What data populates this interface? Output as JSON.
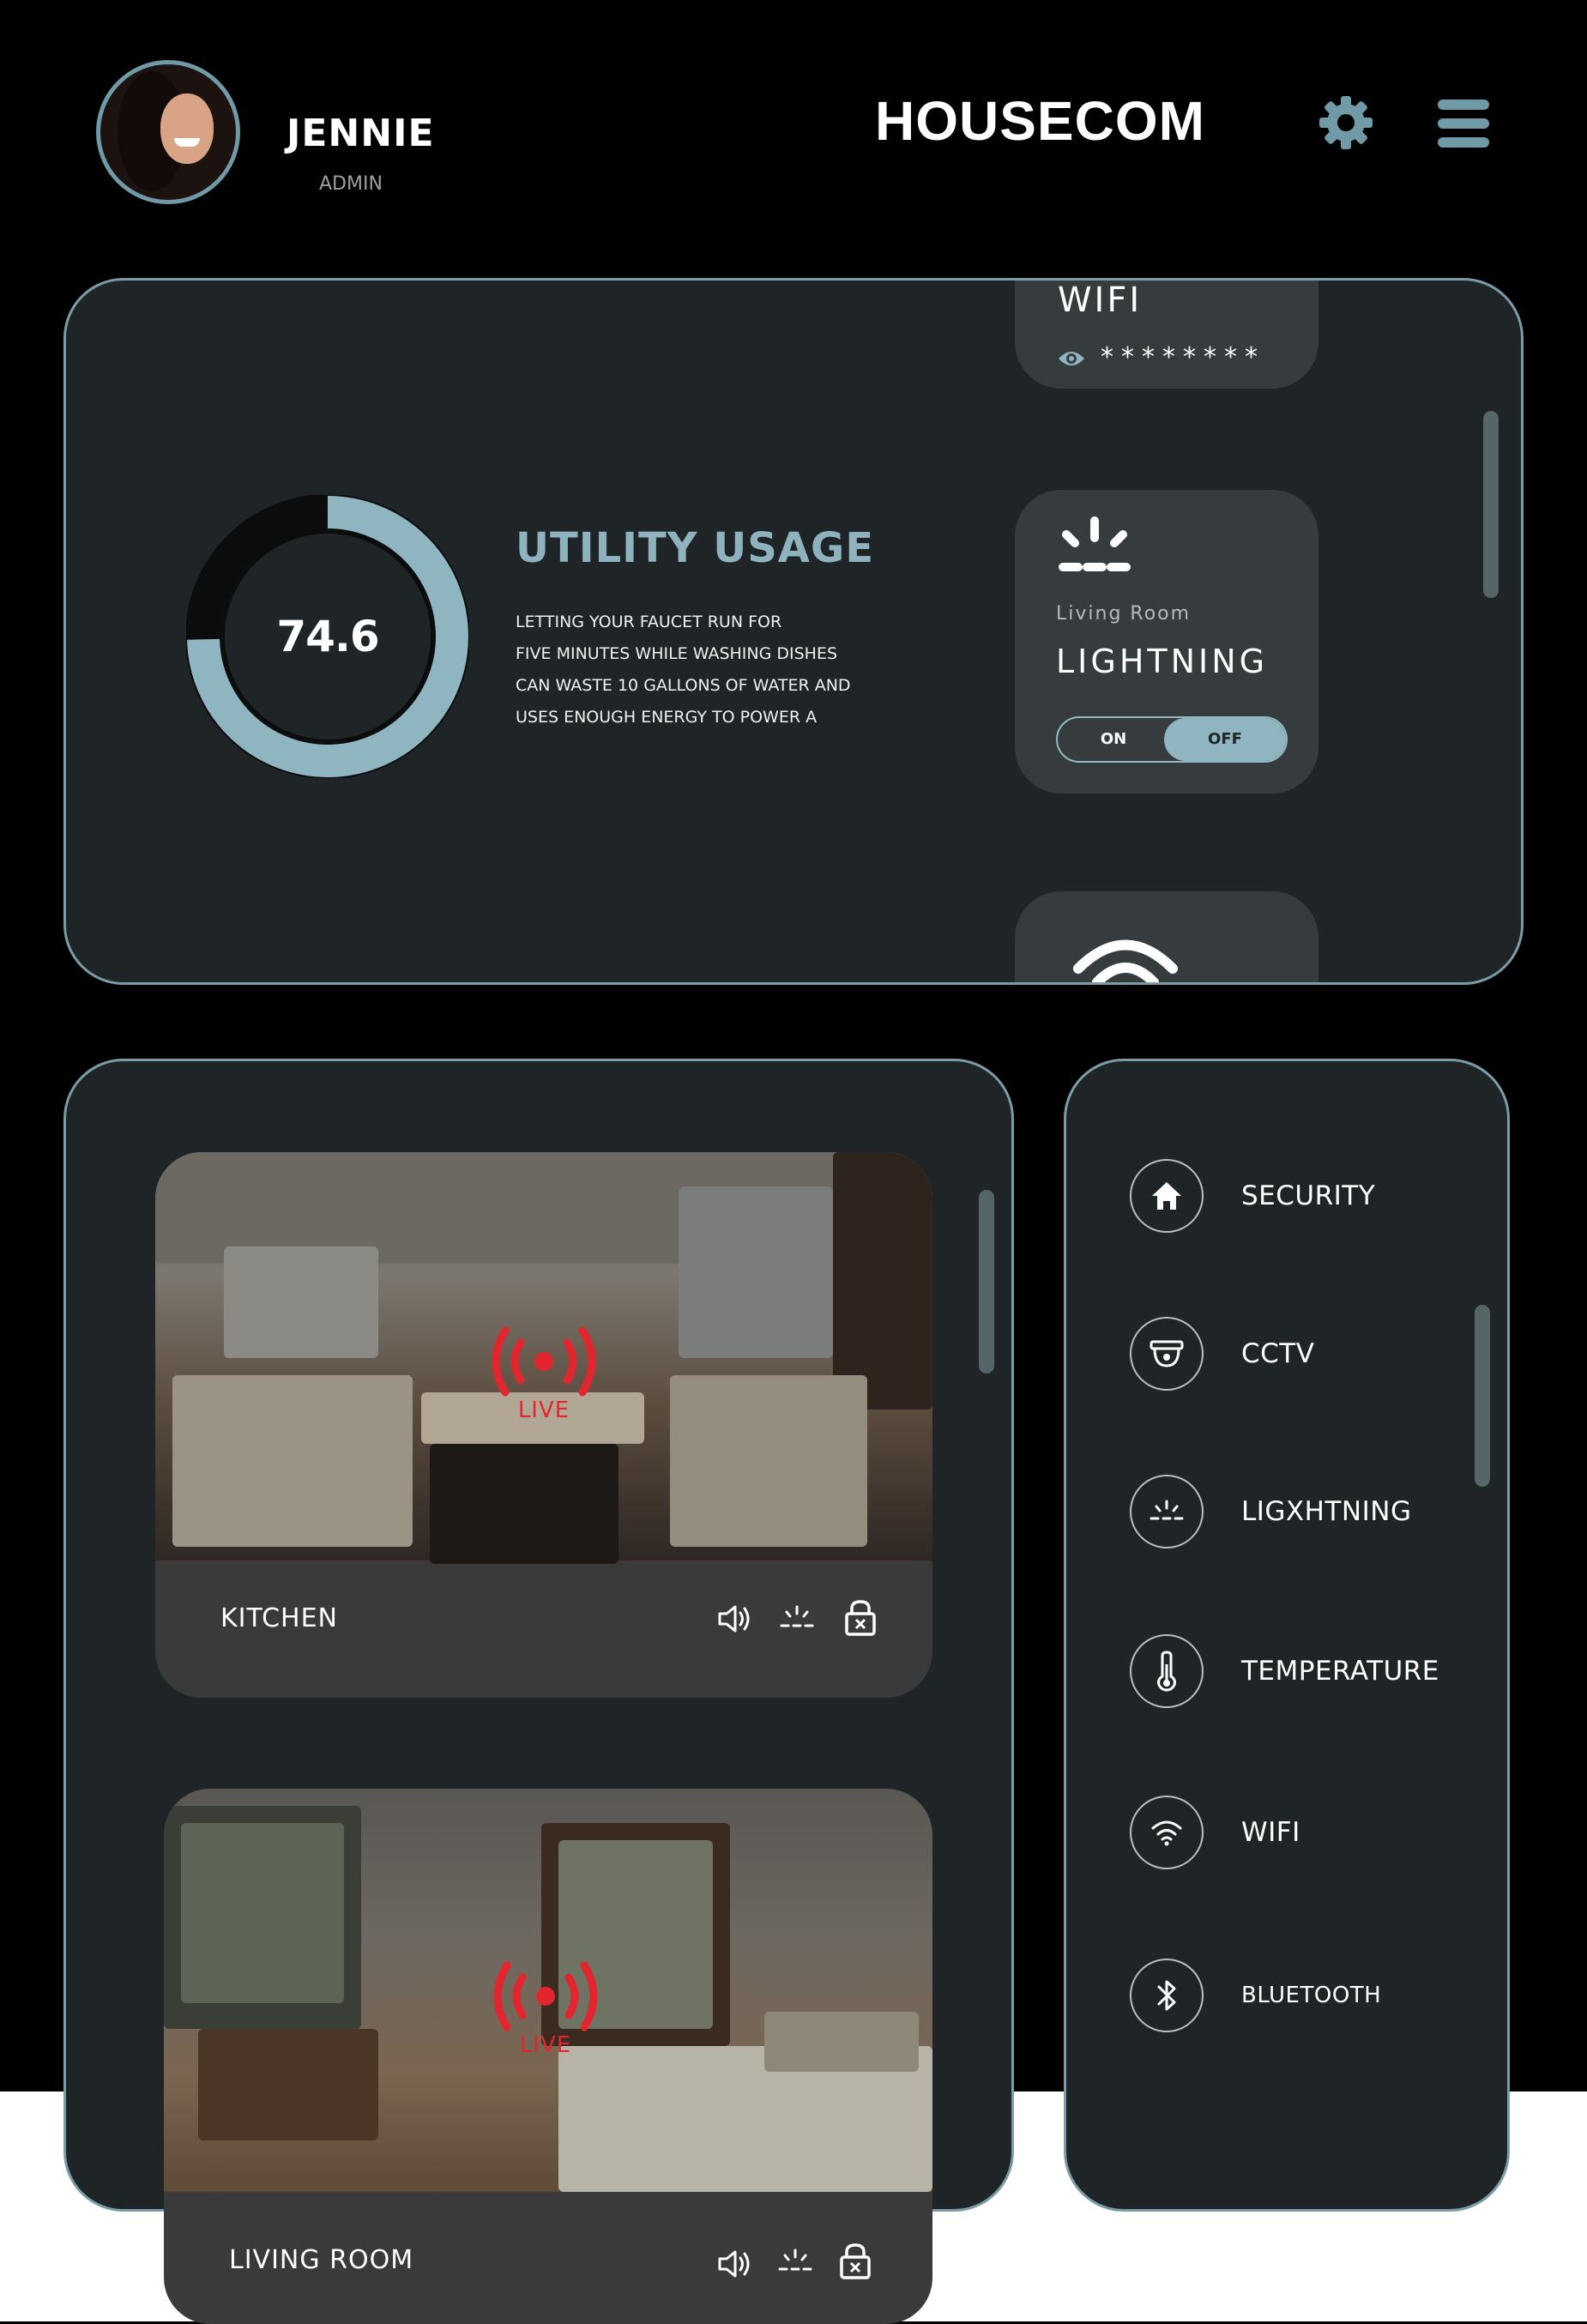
{
  "user": {
    "name": "JENNIE",
    "role": "ADMIN"
  },
  "brand": "HOUSECOM",
  "header_icons": {
    "settings": "gear-icon",
    "menu": "hamburger-menu-icon"
  },
  "utility": {
    "value": "74.6",
    "fraction": 0.746,
    "title": "UTILITY USAGE",
    "lines": [
      "LETTING YOUR FAUCET RUN FOR",
      "FIVE MINUTES WHILE WASHING DISHES",
      "CAN WASTE 10 GALLONS OF WATER AND",
      "USES ENOUGH ENERGY TO POWER A"
    ]
  },
  "wifi_card": {
    "title": "WIFI",
    "password": "********"
  },
  "lighting_card": {
    "room": "Living Room",
    "title": "LIGHTNING",
    "toggle_on": "ON",
    "toggle_off": "OFF",
    "state": "OFF"
  },
  "cameras": [
    {
      "name": "KITCHEN",
      "live": "LIVE"
    },
    {
      "name": "LIVING ROOM",
      "live": "LIVE"
    }
  ],
  "nav": [
    {
      "label": "SECURITY",
      "icon": "home-icon"
    },
    {
      "label": "CCTV",
      "icon": "cctv-camera-icon"
    },
    {
      "label": "LIGXHTNING",
      "icon": "light-icon"
    },
    {
      "label": "TEMPERATURE",
      "icon": "thermometer-icon"
    },
    {
      "label": "WIFI",
      "icon": "wifi-icon"
    },
    {
      "label": "BLUETOOTH",
      "icon": "bluetooth-icon"
    }
  ],
  "colors": {
    "accent": "#8fb5c0",
    "panel": "#1f2527",
    "card": "#363c3d",
    "live": "#e3262d"
  }
}
